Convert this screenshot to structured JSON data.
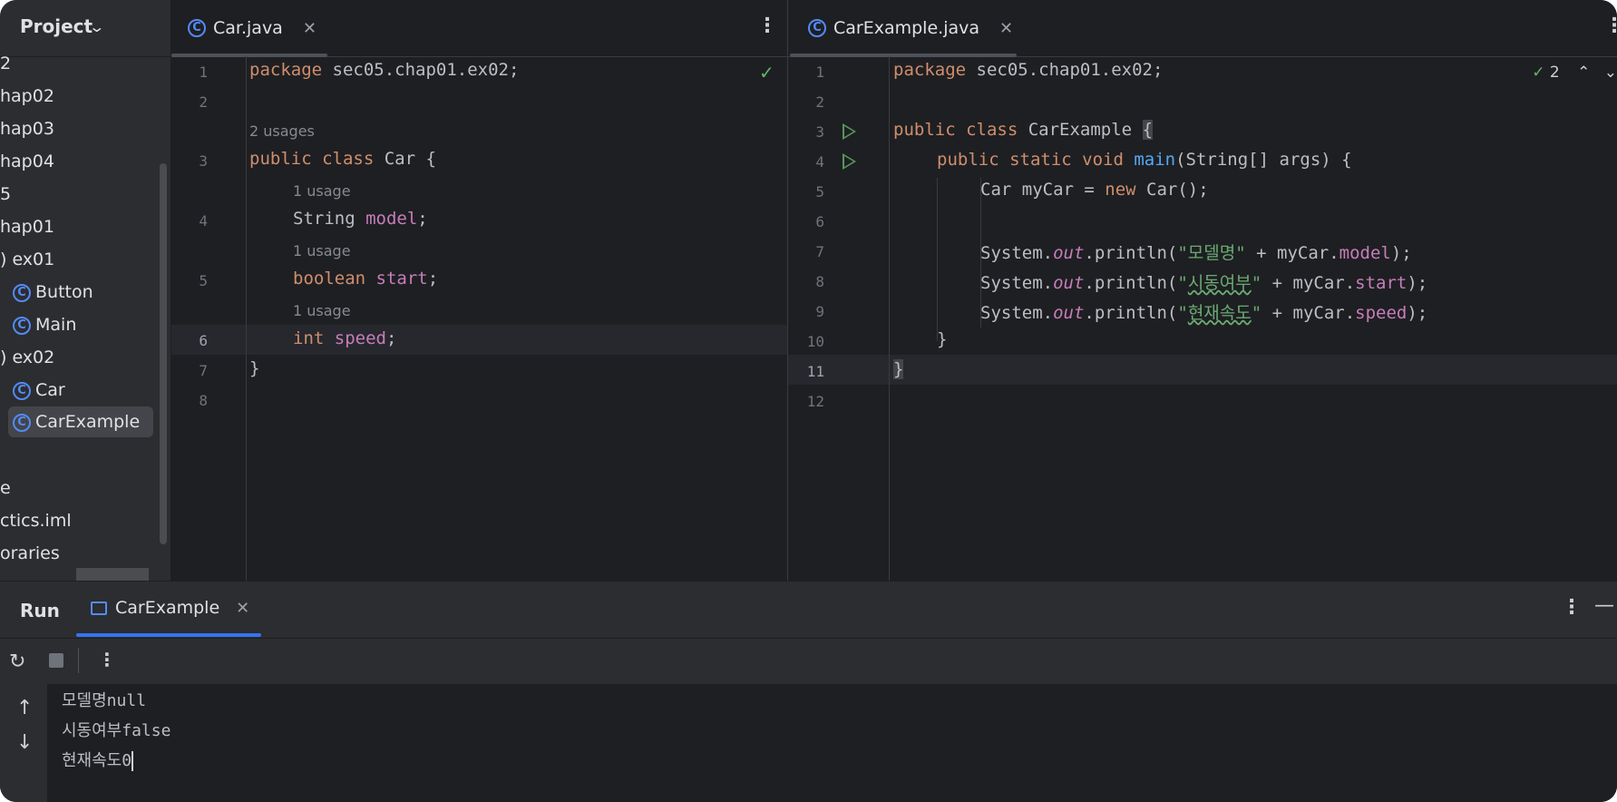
{
  "sidebar": {
    "title": "Project",
    "items": [
      {
        "label": "2",
        "icon": false
      },
      {
        "label": "hap02",
        "icon": false
      },
      {
        "label": "hap03",
        "icon": false
      },
      {
        "label": "hap04",
        "icon": false
      },
      {
        "label": "5",
        "icon": false
      },
      {
        "label": "hap01",
        "icon": false
      },
      {
        "label": ") ex01",
        "icon": false
      },
      {
        "label": "Button",
        "icon": true
      },
      {
        "label": "Main",
        "icon": true
      },
      {
        "label": ") ex02",
        "icon": false
      },
      {
        "label": "Car",
        "icon": true
      },
      {
        "label": "CarExample",
        "icon": true
      },
      {
        "label": "e",
        "icon": false
      },
      {
        "label": "ctics.iml",
        "icon": false
      },
      {
        "label": "oraries",
        "icon": false
      }
    ],
    "selected": "CarExample"
  },
  "left_editor": {
    "tab_label": "Car.java",
    "line_numbers": [
      "1",
      "2",
      "3",
      "4",
      "5",
      "6",
      "7",
      "8"
    ],
    "hints": [
      "2 usages",
      "1 usage",
      "1 usage",
      "1 usage"
    ],
    "code": {
      "l1_kw": "package",
      "l1_rest": " sec05.chap01.ex02;",
      "l3_kw": "public class",
      "l3_rest": " Car {",
      "l4_type": "String ",
      "l4_field": "model",
      "l4_end": ";",
      "l5_kw": "boolean ",
      "l5_field": "start",
      "l5_end": ";",
      "l6_kw": "int ",
      "l6_field": "speed",
      "l6_end": ";",
      "l7": "}"
    }
  },
  "right_editor": {
    "tab_label": "CarExample.java",
    "problems_count": "2",
    "line_numbers": [
      "1",
      "2",
      "3",
      "4",
      "5",
      "6",
      "7",
      "8",
      "9",
      "10",
      "11",
      "12"
    ],
    "code": {
      "l1_kw": "package",
      "l1_rest": " sec05.chap01.ex02;",
      "l3_kw": "public class",
      "l3_rest": " CarExample ",
      "l3_brace": "{",
      "l4_kw": "public static void ",
      "l4_fn": "main",
      "l4_rest": "(String[] args) {",
      "l5_a": "Car myCar = ",
      "l5_kw": "new",
      "l5_b": " Car();",
      "sys": "System.",
      "out": "out",
      "println": ".println(",
      "l7_str": "\"모델명\"",
      "l7_mid": " + myCar.",
      "l7_field": "model",
      "l7_end": ");",
      "l8_str_q1": "\"",
      "l8_str": "시동여부",
      "l8_str_q2": "\"",
      "l8_mid": " + myCar.",
      "l8_field": "start",
      "l8_end": ");",
      "l9_str_q1": "\"",
      "l9_str": "현재속도",
      "l9_str_q2": "\"",
      "l9_mid": " + myCar.",
      "l9_field": "speed",
      "l9_end": ");",
      "l10": "}",
      "l11": "}"
    }
  },
  "run_panel": {
    "title": "Run",
    "tab_label": "CarExample",
    "output": [
      "모델명null",
      "시동여부false",
      "현재속도0"
    ]
  },
  "colors": {
    "accent": "#3574f0",
    "keyword": "#cf8e6d",
    "field": "#c77dbb",
    "string": "#6aab73",
    "function": "#56a8f5"
  }
}
